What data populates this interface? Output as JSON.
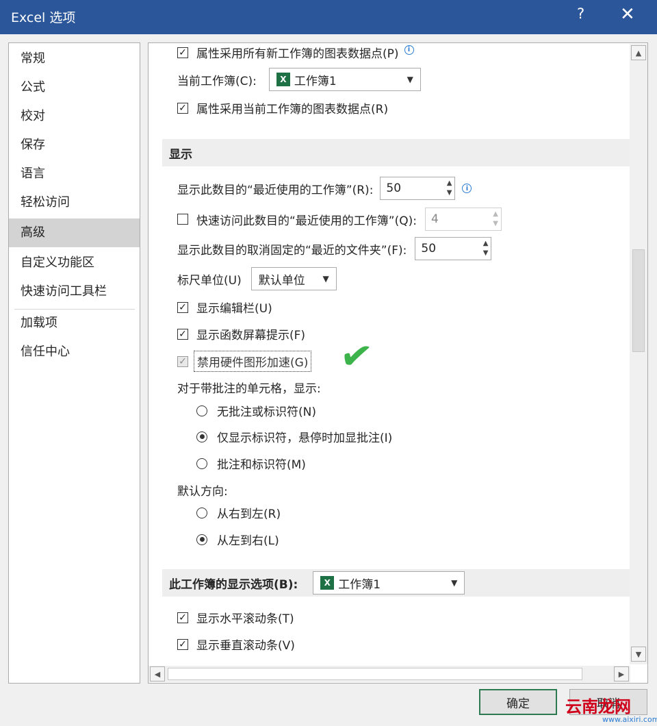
{
  "window": {
    "title": "Excel 选项",
    "help": "?",
    "close": "✕"
  },
  "sidebar": {
    "items": [
      {
        "label": "常规"
      },
      {
        "label": "公式"
      },
      {
        "label": "校对"
      },
      {
        "label": "保存"
      },
      {
        "label": "语言"
      },
      {
        "label": "轻松访问"
      },
      {
        "label": "高级"
      },
      {
        "label": "自定义功能区"
      },
      {
        "label": "快速访问工具栏"
      },
      {
        "label": "加载项"
      },
      {
        "label": "信任中心"
      }
    ],
    "selected": "高级"
  },
  "content": {
    "top": {
      "prop_all_new": {
        "label": "属性采用所有新工作簿的图表数据点(P)",
        "checked": true
      },
      "current_workbook": {
        "label": "当前工作簿(C):",
        "value": "工作簿1"
      },
      "prop_current": {
        "label": "属性采用当前工作簿的图表数据点(R)",
        "checked": true
      }
    },
    "display": {
      "header": "显示",
      "recent_workbooks": {
        "label": "显示此数目的“最近使用的工作簿”(R):",
        "value": "50"
      },
      "quick_access": {
        "label": "快速访问此数目的“最近使用的工作簿”(Q):",
        "value": "4",
        "checked": false
      },
      "recent_folders": {
        "label": "显示此数目的取消固定的“最近的文件夹”(F):",
        "value": "50"
      },
      "ruler_units": {
        "label": "标尺单位(U)",
        "value": "默认单位"
      },
      "formula_bar": {
        "label": "显示编辑栏(U)",
        "checked": true
      },
      "function_tips": {
        "label": "显示函数屏幕提示(F)",
        "checked": true
      },
      "disable_hw": {
        "label": "禁用硬件图形加速(G)",
        "checked": true,
        "enabled": false
      },
      "comments_label": "对于带批注的单元格，显示:",
      "comments_options": [
        {
          "label": "无批注或标识符(N)",
          "selected": false
        },
        {
          "label": "仅显示标识符，悬停时加显批注(I)",
          "selected": true
        },
        {
          "label": "批注和标识符(M)",
          "selected": false
        }
      ],
      "direction_label": "默认方向:",
      "direction_options": [
        {
          "label": "从右到左(R)",
          "selected": false
        },
        {
          "label": "从左到右(L)",
          "selected": true
        }
      ]
    },
    "workbook_display": {
      "header": "此工作簿的显示选项(B):",
      "value": "工作簿1",
      "hscroll": {
        "label": "显示水平滚动条(T)",
        "checked": true
      },
      "vscroll": {
        "label": "显示垂直滚动条(V)",
        "checked": true
      }
    }
  },
  "buttons": {
    "ok": "确定",
    "cancel": "取消"
  },
  "icons": {
    "checkbox_checked": "✓",
    "excel_letter": "X",
    "info_letter": "i",
    "dropdown_arrow": "▼",
    "spin_up": "▲",
    "spin_down": "▼",
    "scroll_up": "▲",
    "scroll_down": "▼",
    "scroll_left": "◀",
    "scroll_right": "▶",
    "annotation_check": "✔"
  },
  "watermark": {
    "text": "云南龙网",
    "url": "www.aixiri.com"
  },
  "colors": {
    "titlebar": "#2b579a",
    "excel_green": "#1e7145",
    "info_blue": "#2b7cd3",
    "annotation_green": "#3cb44b"
  }
}
